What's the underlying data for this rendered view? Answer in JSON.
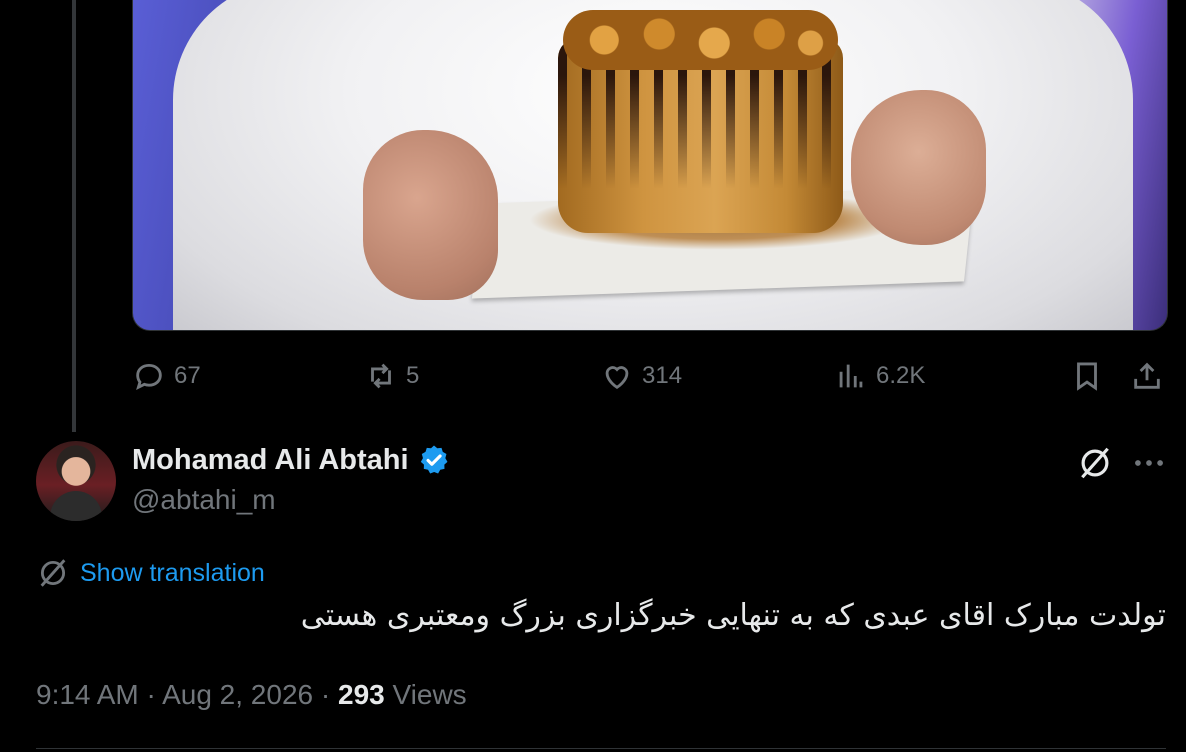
{
  "tweet_actions": {
    "replies": "67",
    "reposts": "5",
    "likes": "314",
    "views": "6.2K"
  },
  "author": {
    "name": "Mohamad Ali Abtahi",
    "handle": "@abtahi_m",
    "verified": true
  },
  "translate_label": "Show translation",
  "tweet_text": "تولدت مبارک اقای عبدی که به تنهایی خبرگزاری بزرگ ومعتبری هستی",
  "meta": {
    "time": "9:14 AM",
    "separator": "·",
    "date": "Aug 2, 2026",
    "view_count": "293",
    "views_label": "Views"
  },
  "colors": {
    "background": "#000000",
    "text": "#e7e9ea",
    "muted": "#71767b",
    "link": "#1d9bf0",
    "verified": "#1d9bf0"
  },
  "icons": [
    "reply-icon",
    "repost-icon",
    "like-icon",
    "views-icon",
    "bookmark-icon",
    "share-icon",
    "grok-icon",
    "more-icon",
    "translate-icon",
    "verified-badge-icon"
  ]
}
